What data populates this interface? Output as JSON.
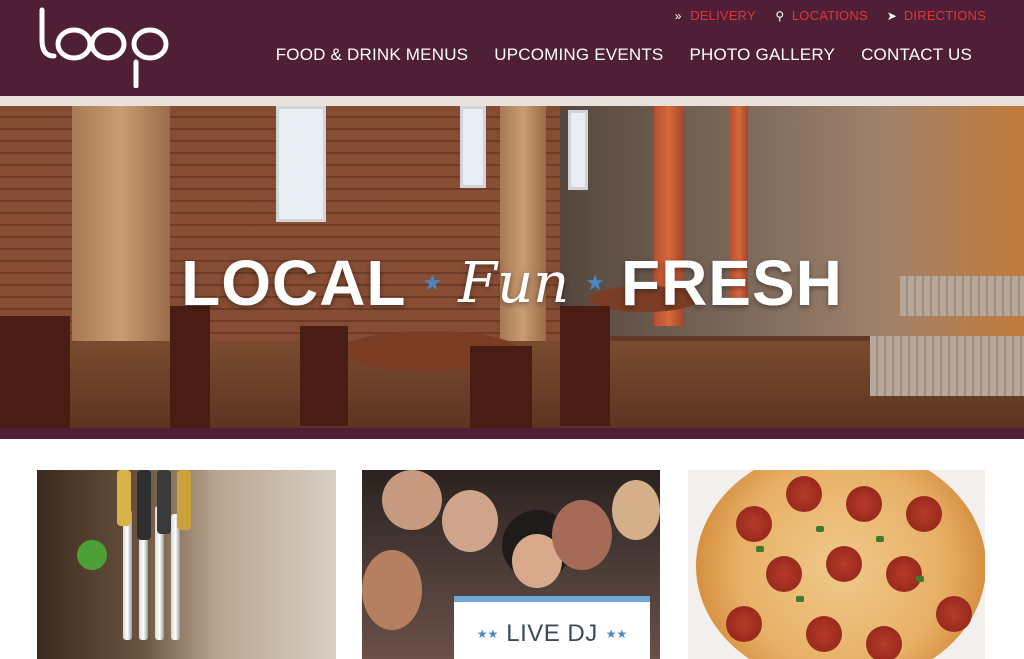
{
  "header": {
    "logo_text": "loop",
    "utility_links": [
      {
        "label": "DELIVERY",
        "icon": "double-chevron-right-icon"
      },
      {
        "label": "LOCATIONS",
        "icon": "map-pin-icon"
      },
      {
        "label": "DIRECTIONS",
        "icon": "navigation-arrow-icon"
      }
    ],
    "nav": [
      {
        "label": "FOOD & DRINK MENUS"
      },
      {
        "label": "UPCOMING EVENTS"
      },
      {
        "label": "PHOTO GALLERY"
      },
      {
        "label": "CONTACT US"
      }
    ]
  },
  "hero": {
    "word1": "LOCAL",
    "word2": "Fun",
    "word3": "FRESH"
  },
  "cards": {
    "dj_label": "LIVE DJ"
  },
  "colors": {
    "brand_maroon": "#4f1f35",
    "utility_red": "#e0343b",
    "star_blue": "#4a87c0"
  }
}
